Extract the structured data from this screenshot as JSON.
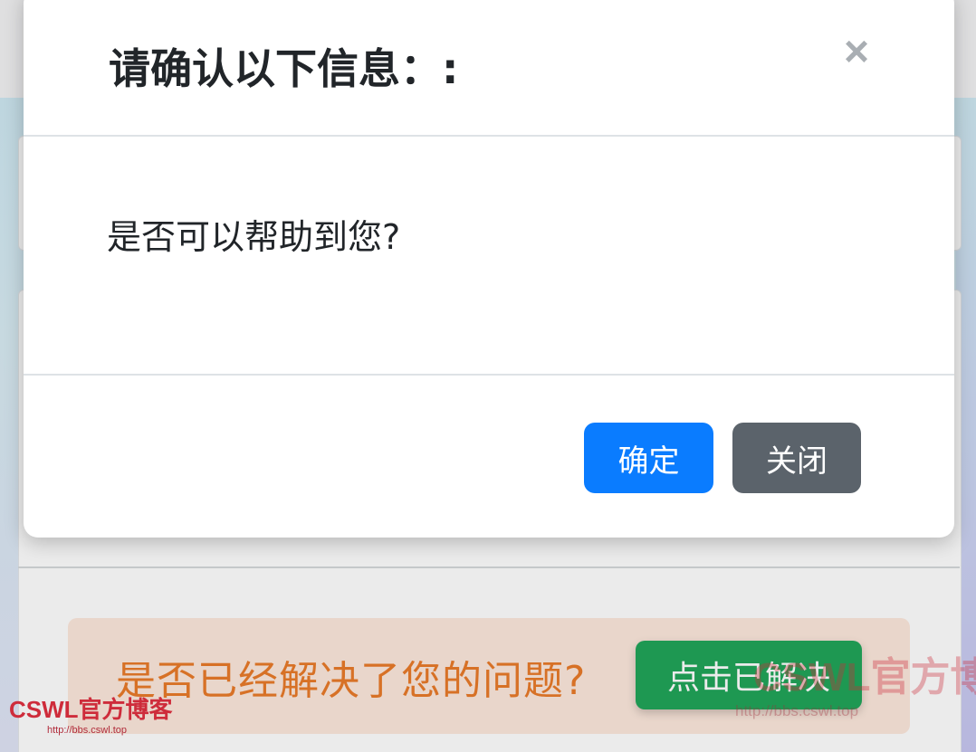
{
  "modal": {
    "title": "请确认以下信息：:",
    "close_glyph": "×",
    "message": "是否可以帮助到您?",
    "confirm_label": "确定",
    "close_label": "关闭"
  },
  "background": {
    "solved_question": "是否已经解决了您的问题?",
    "solved_button_label": "点击已解决"
  },
  "watermark": {
    "brand": "CSWL官方博客",
    "url": "http://bbs.cswl.top"
  },
  "colors": {
    "primary": "#0a7cff",
    "secondary": "#5b636b",
    "success": "#21a55a",
    "warning_text": "#ea7b2a"
  }
}
